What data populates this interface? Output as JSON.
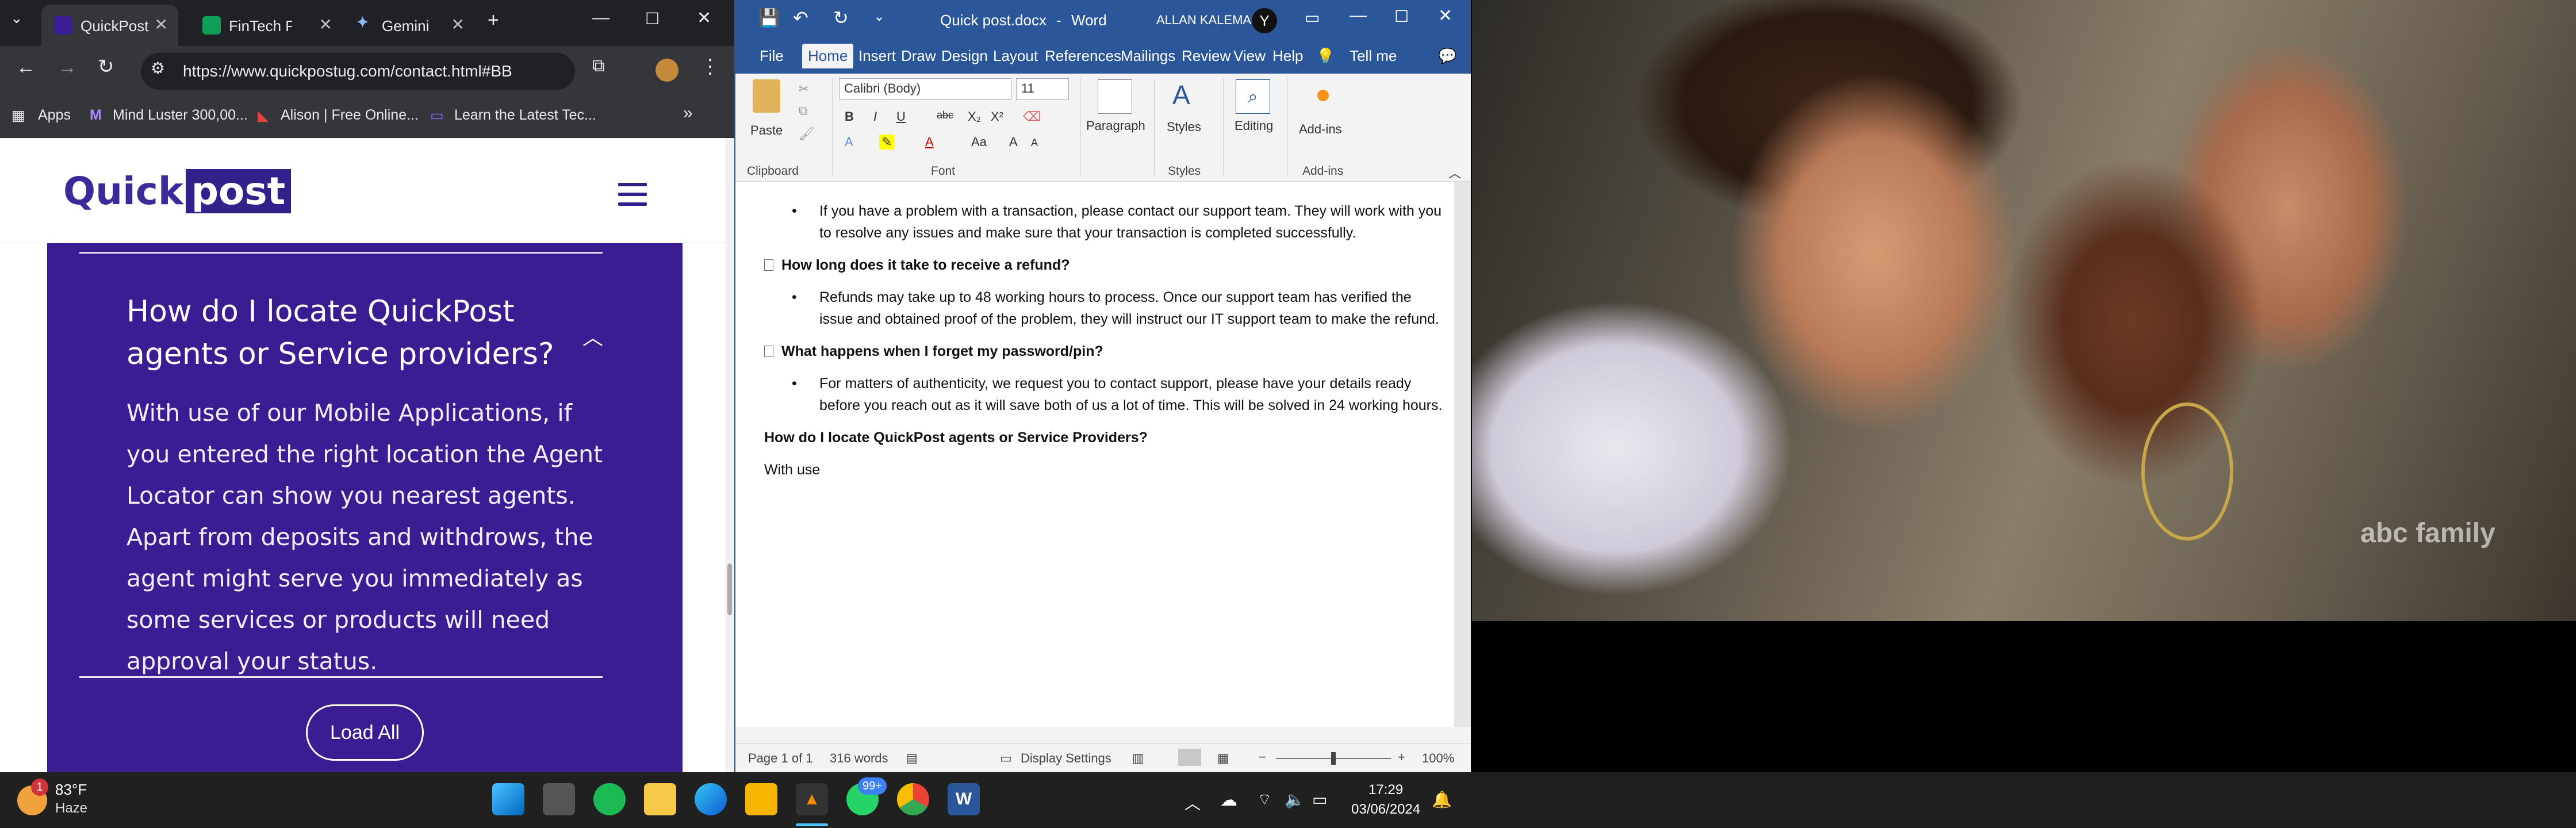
{
  "chrome": {
    "tabs": [
      {
        "title": "QuickPost",
        "active": true
      },
      {
        "title": "FinTech Pr",
        "active": false
      },
      {
        "title": "Gemini",
        "active": false
      }
    ],
    "new_tab": "+",
    "url": "https://www.quickpostug.com/contact.html#BB",
    "bookmarks": [
      "Apps",
      "Mind Luster 300,00...",
      "Alison | Free Online...",
      "Learn the Latest Tec..."
    ],
    "bookmarks_more": "»"
  },
  "site": {
    "logo_left": "Quick",
    "logo_right": "post",
    "faq_question": "How do I locate QuickPost agents or Service providers?",
    "faq_answer": "With use of our Mobile Applications, if you entered the right location the Agent Locator can show you nearest agents. Apart from deposits and withdrows, the agent might serve you immediately as some services or products will need approval your status.",
    "load_button": "Load All"
  },
  "word": {
    "doc_title": "Quick post.docx",
    "app": "Word",
    "user": "ALLAN KALEMA",
    "tabs": [
      "File",
      "Home",
      "Insert",
      "Draw",
      "Design",
      "Layout",
      "References",
      "Mailings",
      "Review",
      "View",
      "Help",
      "Tell me"
    ],
    "font_name": "Calibri (Body)",
    "font_size": "11",
    "groups": {
      "clipboard": "Clipboard",
      "font": "Font",
      "styles": "Styles",
      "addins": "Add-ins",
      "paste": "Paste",
      "paragraph": "Paragraph",
      "styles_btn": "Styles",
      "editing": "Editing",
      "addins_btn": "Add-ins"
    },
    "doc": {
      "b1": "If you have a problem with a transaction, please contact our support team. They will work with you to resolve any issues and make sure that your transaction is completed successfully.",
      "h2": "How long does it take to receive a refund?",
      "b2": "Refunds may take up to 48 working hours to process. Once our support team has verified the issue and obtained proof of the problem, they will instruct our IT support team to make the refund.",
      "h3": "What happens when I forget my password/pin?",
      "b3": "For matters of authenticity, we request you to contact support, please have your details ready before you reach out as it will save both of us a lot of time. This will be solved in 24 working hours.",
      "h4": "How do I locate QuickPost agents or Service Providers?",
      "p5": "With use"
    },
    "status": {
      "page": "Page 1 of 1",
      "words": "316 words",
      "display": "Display Settings",
      "zoom": "100%"
    }
  },
  "video": {
    "watermark": "abc family"
  },
  "taskbar": {
    "weather_temp": "83°F",
    "weather_desc": "Haze",
    "notif_badge": "1",
    "whatsapp_badge": "99+",
    "time": "17:29",
    "date": "03/06/2024"
  }
}
